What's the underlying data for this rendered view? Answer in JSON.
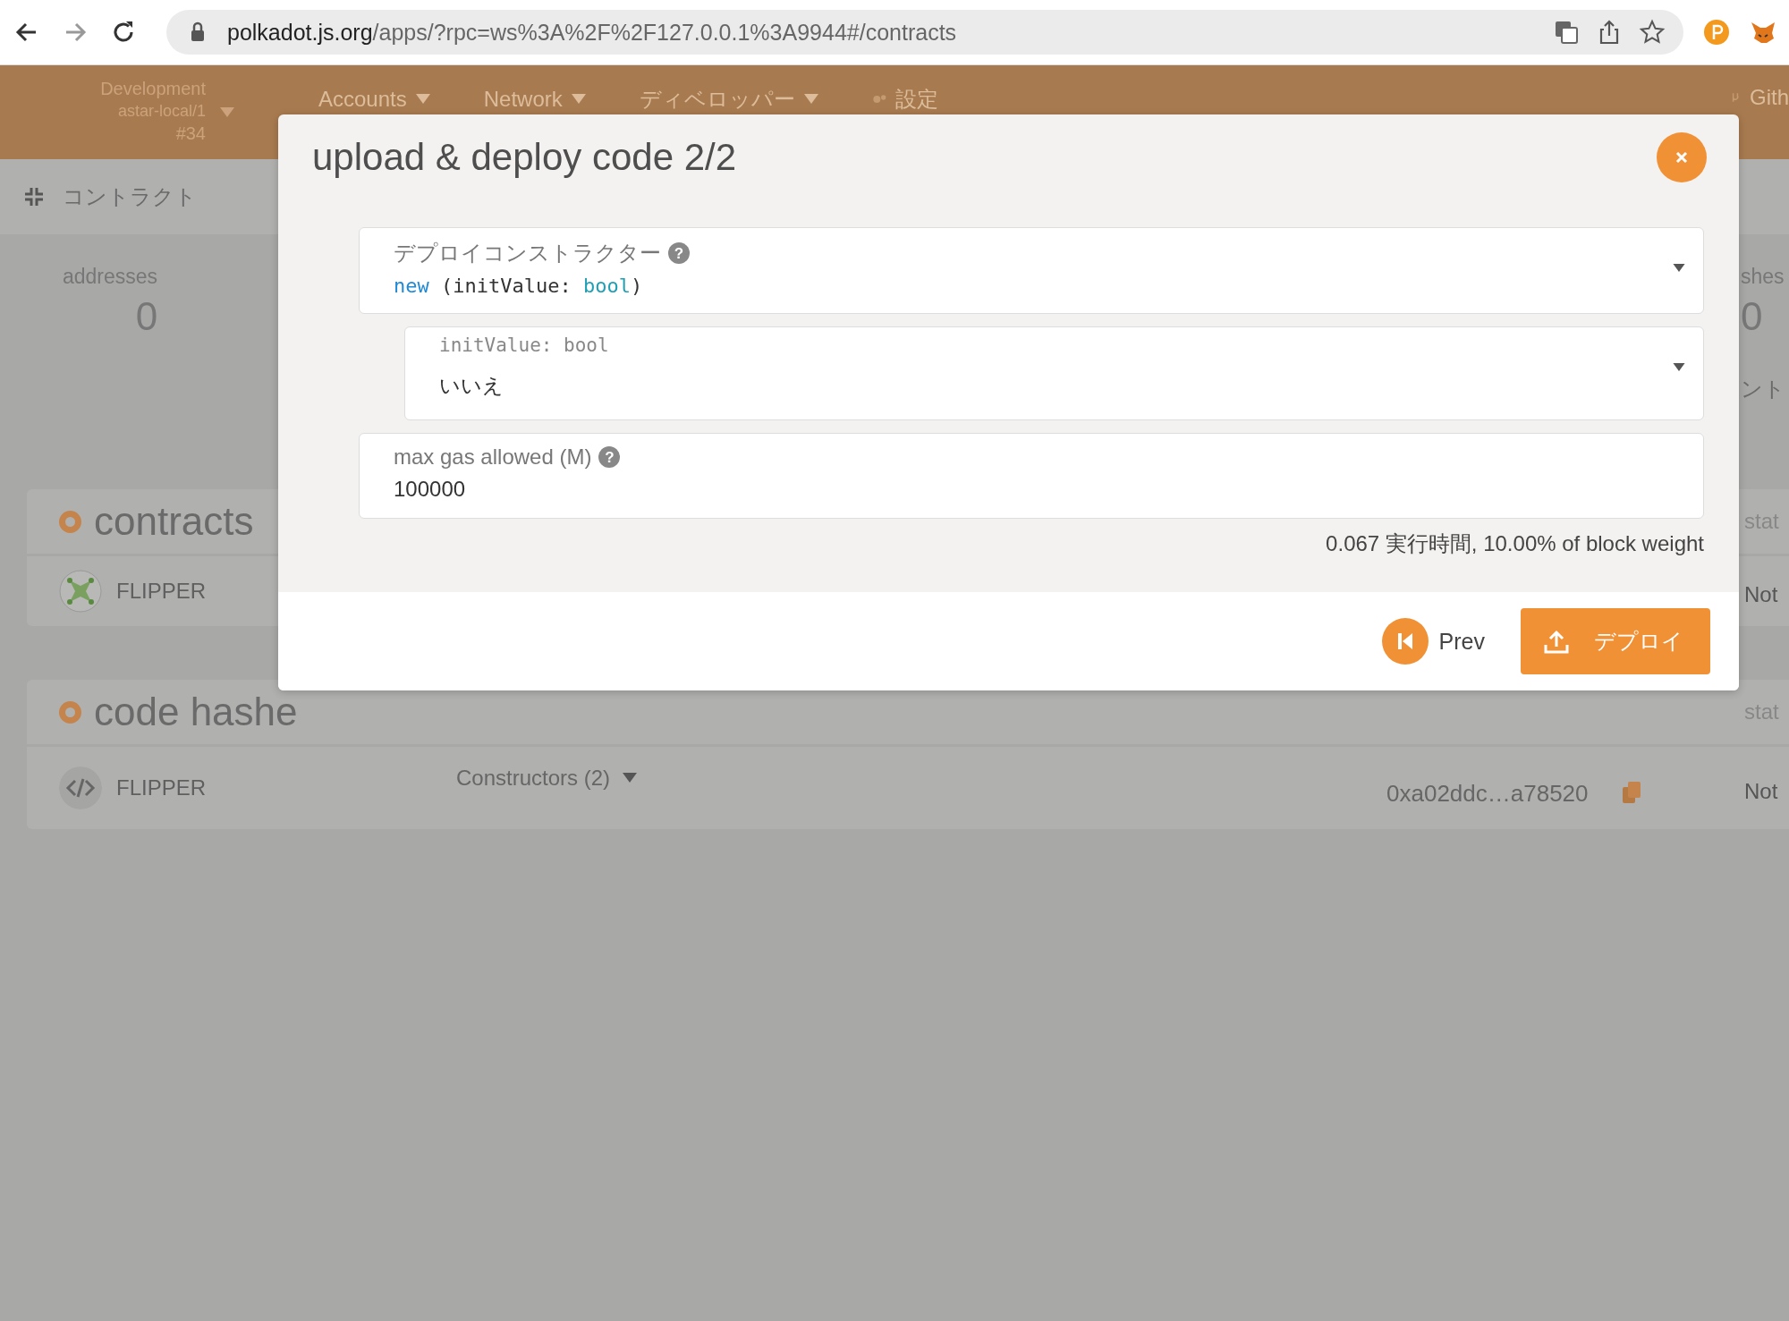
{
  "browser": {
    "url_host": "polkadot.js.org",
    "url_path": "/apps/?rpc=ws%3A%2F%2F127.0.0.1%3A9944#/contracts"
  },
  "header": {
    "chain": {
      "name": "Development",
      "node": "astar-local/1",
      "block": "#34"
    },
    "menus": [
      {
        "label": "Accounts",
        "kind": "dropdown"
      },
      {
        "label": "Network",
        "kind": "dropdown"
      },
      {
        "label": "ディベロッパー",
        "kind": "dropdown"
      },
      {
        "label": "設定",
        "kind": "settings"
      }
    ],
    "github": "Gith"
  },
  "subnav": {
    "label": "コントラクト"
  },
  "summary": {
    "left": {
      "label": "addresses",
      "value": "0"
    },
    "right": {
      "label": "shes",
      "value": "0",
      "note": "ント"
    }
  },
  "sections": [
    {
      "title": "contracts",
      "status_header": "stat",
      "rows": [
        {
          "kind": "contract",
          "name": "FLIPPER",
          "status": "Not"
        }
      ]
    },
    {
      "title": "code hashe",
      "status_header": "stat",
      "rows": [
        {
          "kind": "code",
          "name": "FLIPPER",
          "constructors": "Constructors (2)",
          "hash": "0xa02ddc…a78520",
          "status": "Not"
        }
      ]
    }
  ],
  "modal": {
    "title": "upload & deploy code 2/2",
    "fields": [
      {
        "kind": "dropdown",
        "label": "デプロイコンストラクター",
        "help": "?",
        "tokens": [
          {
            "text": "new",
            "kind": "name"
          },
          {
            "text": " (initValue: ",
            "kind": "plain"
          },
          {
            "text": "bool",
            "kind": "type"
          },
          {
            "text": ")",
            "kind": "plain"
          }
        ]
      },
      {
        "kind": "param",
        "label": "initValue: bool",
        "value": "いいえ"
      },
      {
        "kind": "input",
        "label": "max gas allowed (M)",
        "help": "?",
        "value": "100000"
      }
    ],
    "weight": "0.067 実行時間, 10.00% of block weight",
    "buttons": [
      {
        "label": "Prev",
        "kind": "secondary"
      },
      {
        "label": "デプロイ",
        "kind": "primary"
      }
    ]
  }
}
